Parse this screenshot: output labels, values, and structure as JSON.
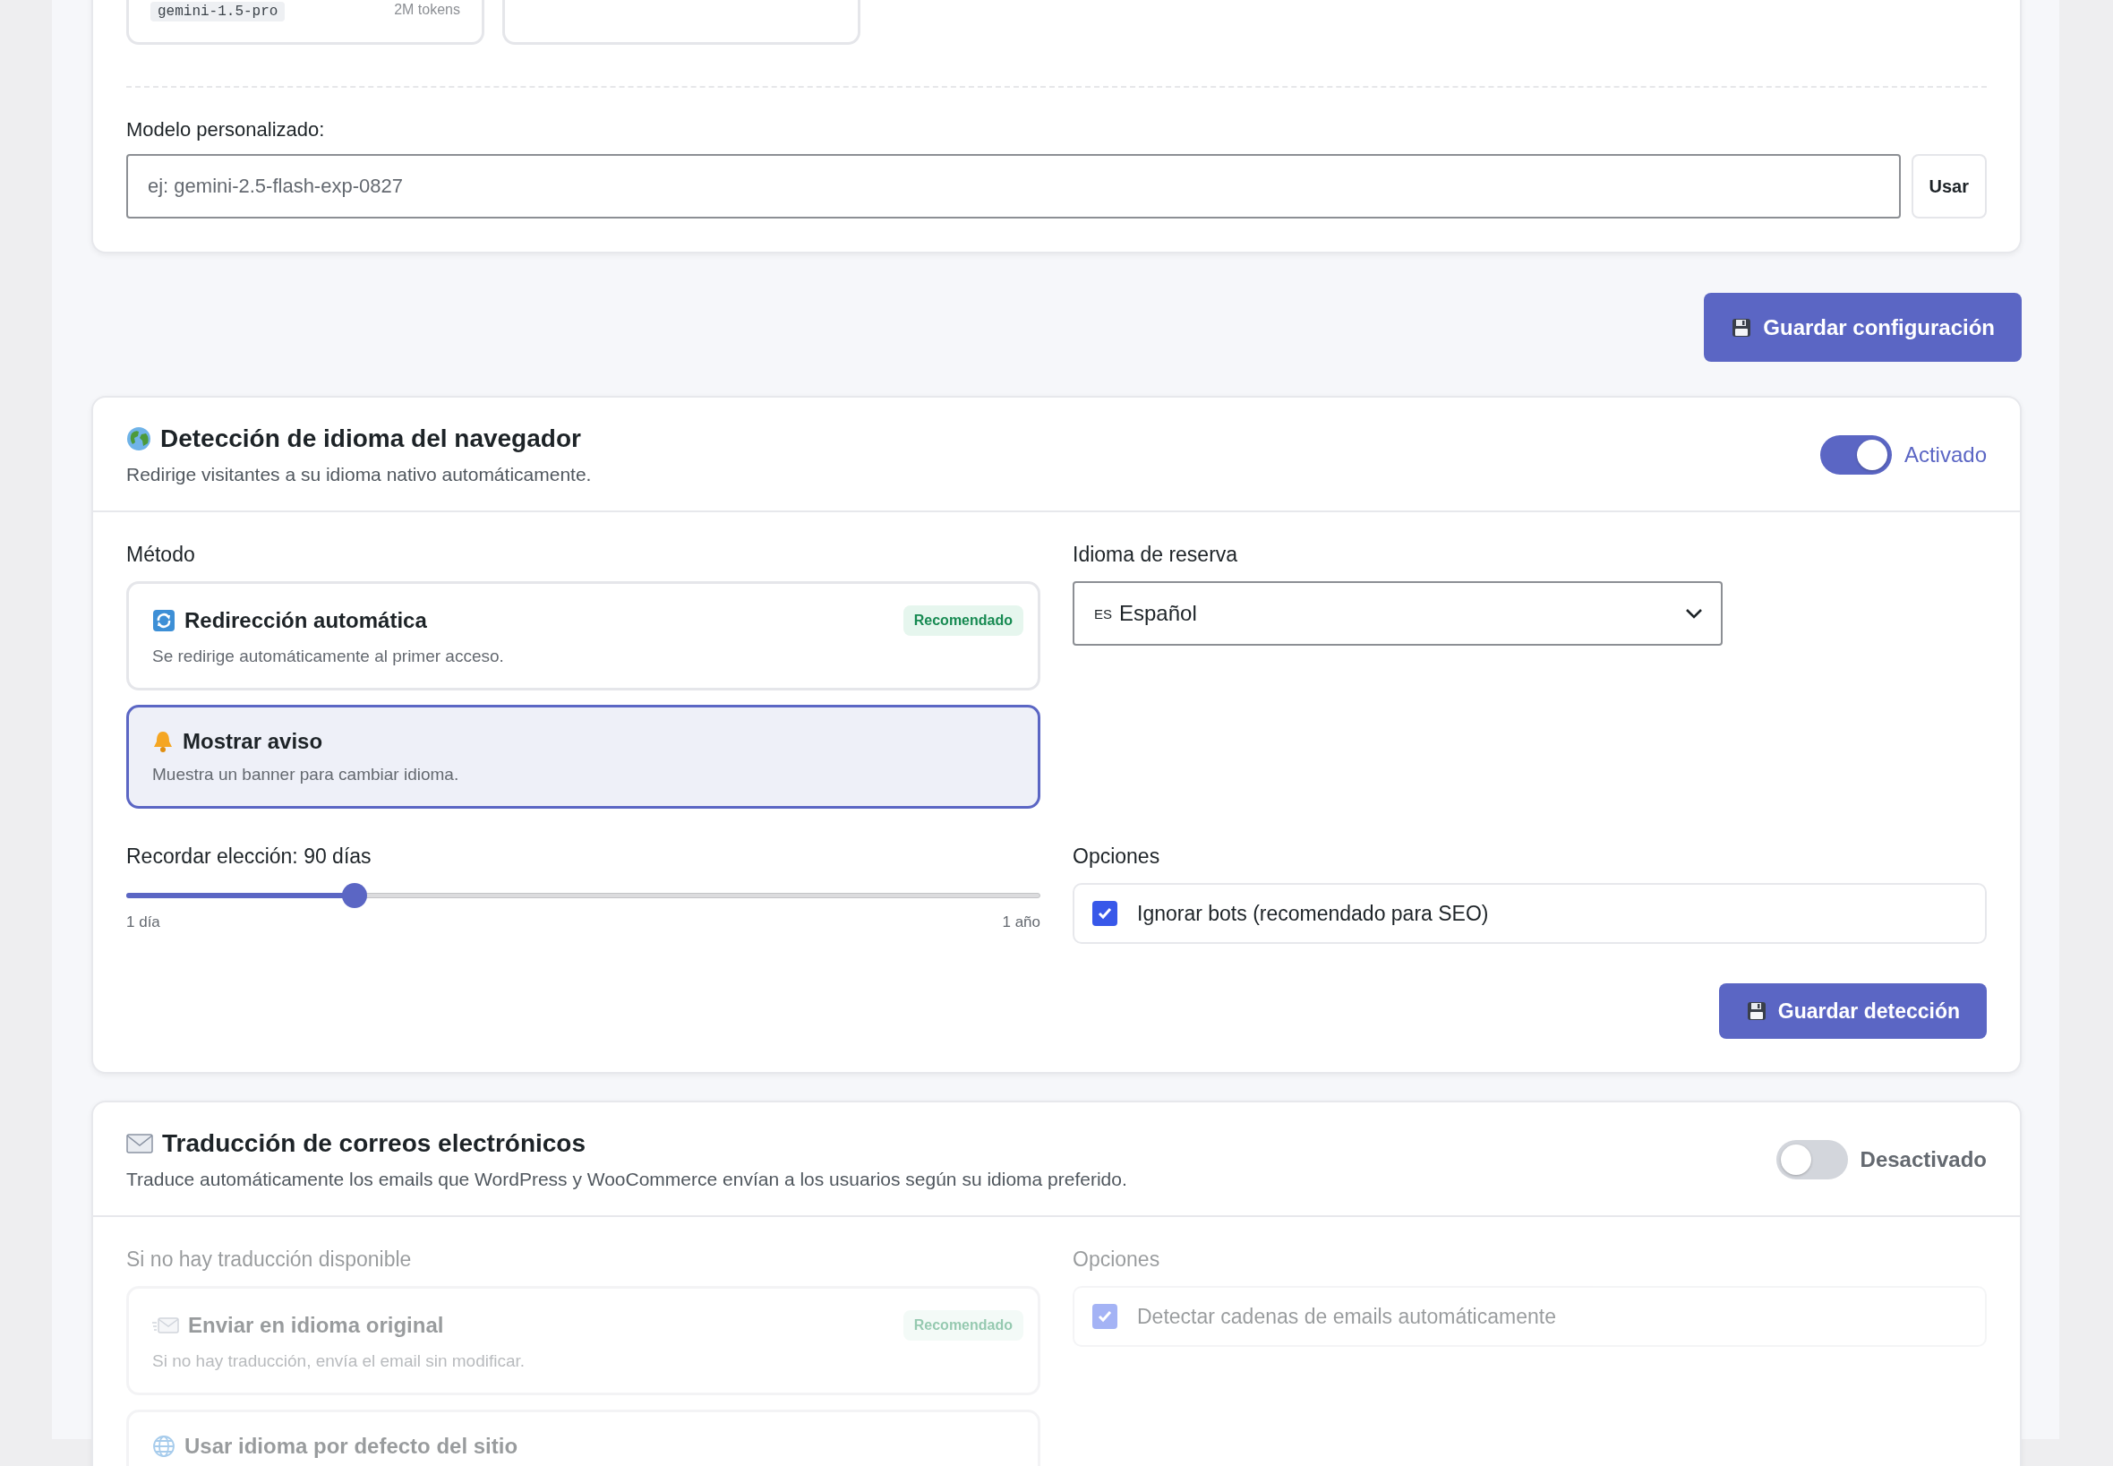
{
  "model_cards": [
    {
      "kind": "model",
      "code": "gemini-1.5-pro",
      "context": "2M tokens"
    },
    {
      "kind": "blank"
    }
  ],
  "custom_model": {
    "label": "Modelo personalizado:",
    "placeholder": "ej: gemini-2.5-flash-exp-0827",
    "button": "Usar"
  },
  "save_button": "Guardar configuración",
  "detection": {
    "title": "Detección de idioma del navegador",
    "description": "Redirige visitantes a su idioma nativo automáticamente.",
    "enabled": true,
    "status": "Activado",
    "method_label": "Método",
    "methods": [
      {
        "title": "Redirección automática",
        "description": "Se redirige automáticamente al primer acceso.",
        "badge": "Recomendado",
        "selected": false
      },
      {
        "title": "Mostrar aviso",
        "description": "Muestra un banner para cambiar idioma.",
        "selected": true
      }
    ],
    "fallback": {
      "label": "Idioma de reserva",
      "flag": "ES",
      "value": "Español"
    },
    "slider": {
      "label": "Recordar elección: 90 días",
      "level": 0.25,
      "min": "1 día",
      "max": "1 año"
    },
    "options_label": "Opciones",
    "options": [
      {
        "label": "Ignorar bots (recomendado para SEO)",
        "checked": true
      }
    ],
    "save_button": "Guardar detección"
  },
  "email": {
    "title": "Traducción de correos electrónicos",
    "description": "Traduce automáticamente los emails que WordPress y WooCommerce envían a los usuarios según su idioma preferido.",
    "enabled": false,
    "status": "Desactivado",
    "method_label": "Si no hay traducción disponible",
    "methods": [
      {
        "title": "Enviar en idioma original",
        "description": "Si no hay traducción, envía el email sin modificar.",
        "badge": "Recomendado",
        "selected": false
      },
      {
        "title": "Usar idioma por defecto del sitio",
        "selected": false
      }
    ],
    "options_label": "Opciones",
    "options": [
      {
        "label": "Detectar cadenas de emails automáticamente",
        "checked": true
      }
    ]
  }
}
